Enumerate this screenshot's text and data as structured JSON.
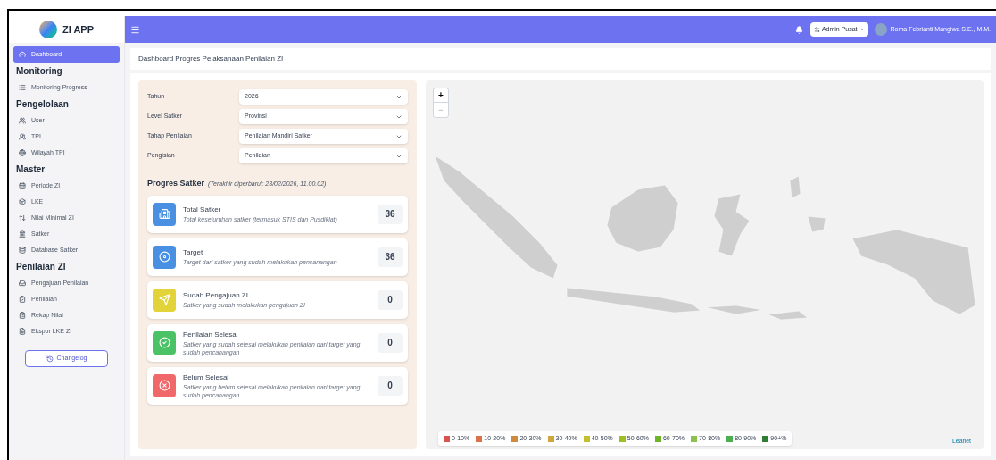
{
  "app": {
    "name": "ZI APP"
  },
  "header": {
    "role": "Admin Pusat",
    "user": "Roma Febrianti Mangiwa S.E., M.M."
  },
  "sidebar": {
    "sections": [
      {
        "items": [
          {
            "label": "Dashboard",
            "selected": true
          }
        ]
      },
      {
        "title": "Monitoring",
        "items": [
          {
            "label": "Monitoring Progress",
            "selected": false
          }
        ]
      },
      {
        "title": "Pengelolaan",
        "items": [
          {
            "label": "User",
            "selected": false
          },
          {
            "label": "TPI",
            "selected": false
          },
          {
            "label": "Wilayah TPI",
            "selected": false
          }
        ]
      },
      {
        "title": "Master",
        "items": [
          {
            "label": "Periode ZI",
            "selected": false
          },
          {
            "label": "LKE",
            "selected": false
          },
          {
            "label": "Nilai Minimal ZI",
            "selected": false
          },
          {
            "label": "Satker",
            "selected": false
          },
          {
            "label": "Database Satker",
            "selected": false
          }
        ]
      },
      {
        "title": "Penilaian ZI",
        "items": [
          {
            "label": "Pengajuan Penilaian",
            "selected": false
          },
          {
            "label": "Penilaian",
            "selected": false
          },
          {
            "label": "Rekap Nilai",
            "selected": false
          },
          {
            "label": "Ekspor LKE ZI",
            "selected": false
          }
        ]
      }
    ],
    "changelog": "Changelog"
  },
  "page": {
    "title": "Dashboard Progres Pelaksanaan Penilaian ZI"
  },
  "filters": [
    {
      "label": "Tahun",
      "value": "2026"
    },
    {
      "label": "Level Satker",
      "value": "Provinsi"
    },
    {
      "label": "Tahap Penilaian",
      "value": "Penilaian Mandiri Satker"
    },
    {
      "label": "Pengisian",
      "value": "Penilaian"
    }
  ],
  "progress": {
    "title": "Progres Satker",
    "updated": "(Terakhir diperbarui: 23/02/2026, 11.00.02)",
    "cards": [
      {
        "kind": "total",
        "title": "Total Satker",
        "description": "Total keseluruhan satker (termasuk STIS dan Pusdiklat)",
        "count": "36"
      },
      {
        "kind": "target",
        "title": "Target",
        "description": "Target dari satker yang sudah melakukan pencanangan",
        "count": "36"
      },
      {
        "kind": "submitted",
        "title": "Sudah Pengajuan ZI",
        "description": "Satker yang sudah melakukan pengajuan ZI",
        "count": "0"
      },
      {
        "kind": "done",
        "title": "Penilaian Selesai",
        "description": "Satker yang sudah selesai melakukan penilaian dari target yang sudah pencanangan",
        "count": "0"
      },
      {
        "kind": "pending",
        "title": "Belum Selesai",
        "description": "Satker yang belum selesai melakukan penilaian dari target yang sudah pencanangan",
        "count": "0"
      }
    ]
  },
  "map": {
    "zoom_in": "+",
    "zoom_out": "−",
    "attribution": "Leaflet",
    "legend": [
      {
        "label": "0-10%",
        "color": "#d9534f"
      },
      {
        "label": "10-20%",
        "color": "#d9714a"
      },
      {
        "label": "20-30%",
        "color": "#d08a3e"
      },
      {
        "label": "30-40%",
        "color": "#cfa63a"
      },
      {
        "label": "40-50%",
        "color": "#c4c02c"
      },
      {
        "label": "50-60%",
        "color": "#9cbf26"
      },
      {
        "label": "60-70%",
        "color": "#6bb526"
      },
      {
        "label": "70-80%",
        "color": "#8cc152"
      },
      {
        "label": "80-90%",
        "color": "#4caf50"
      },
      {
        "label": "90+%",
        "color": "#2e7d32"
      }
    ]
  }
}
